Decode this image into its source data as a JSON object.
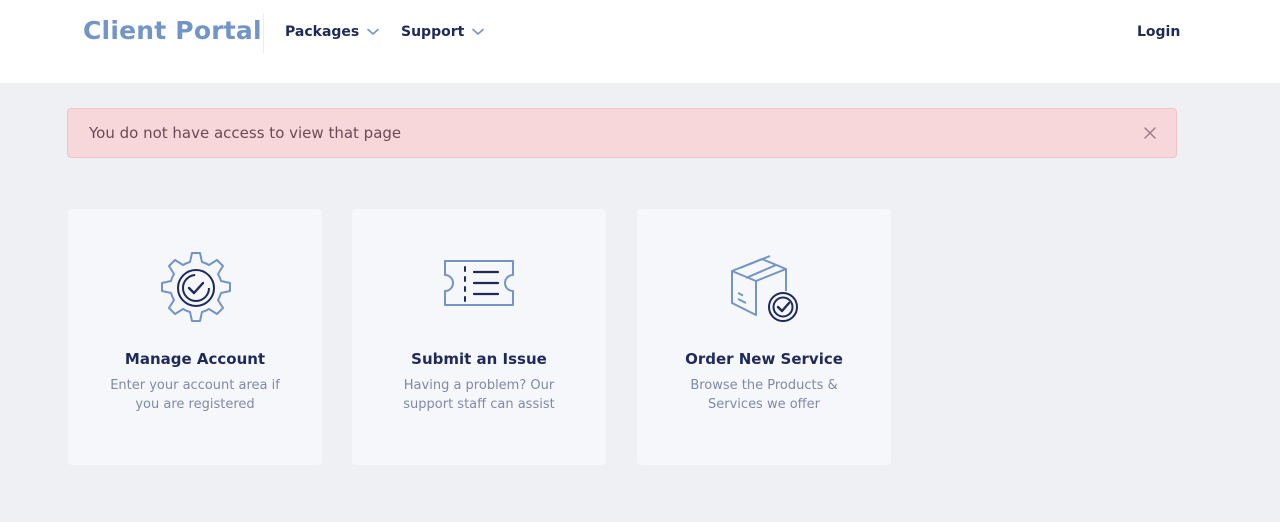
{
  "header": {
    "brand": "Client Portal",
    "nav": [
      {
        "label": "Packages",
        "icon": "chevron-down-icon"
      },
      {
        "label": "Support",
        "icon": "chevron-down-icon"
      }
    ],
    "login_label": "Login"
  },
  "alert": {
    "message": "You do not have access to view that page",
    "close_icon": "close-icon",
    "background": "#f8d7da"
  },
  "cards": [
    {
      "title": "Manage Account",
      "description": "Enter your account area if you are registered",
      "icon": "gear-check-icon"
    },
    {
      "title": "Submit an Issue",
      "description": "Having a problem? Our support staff can assist",
      "icon": "ticket-icon"
    },
    {
      "title": "Order New Service",
      "description": "Browse the Products & Services we offer",
      "icon": "package-check-icon"
    }
  ],
  "colors": {
    "brand": "#7394c6",
    "primary_text": "#1f2a5a",
    "muted_text": "#7f8aa8",
    "page_bg": "#eef0f4"
  }
}
